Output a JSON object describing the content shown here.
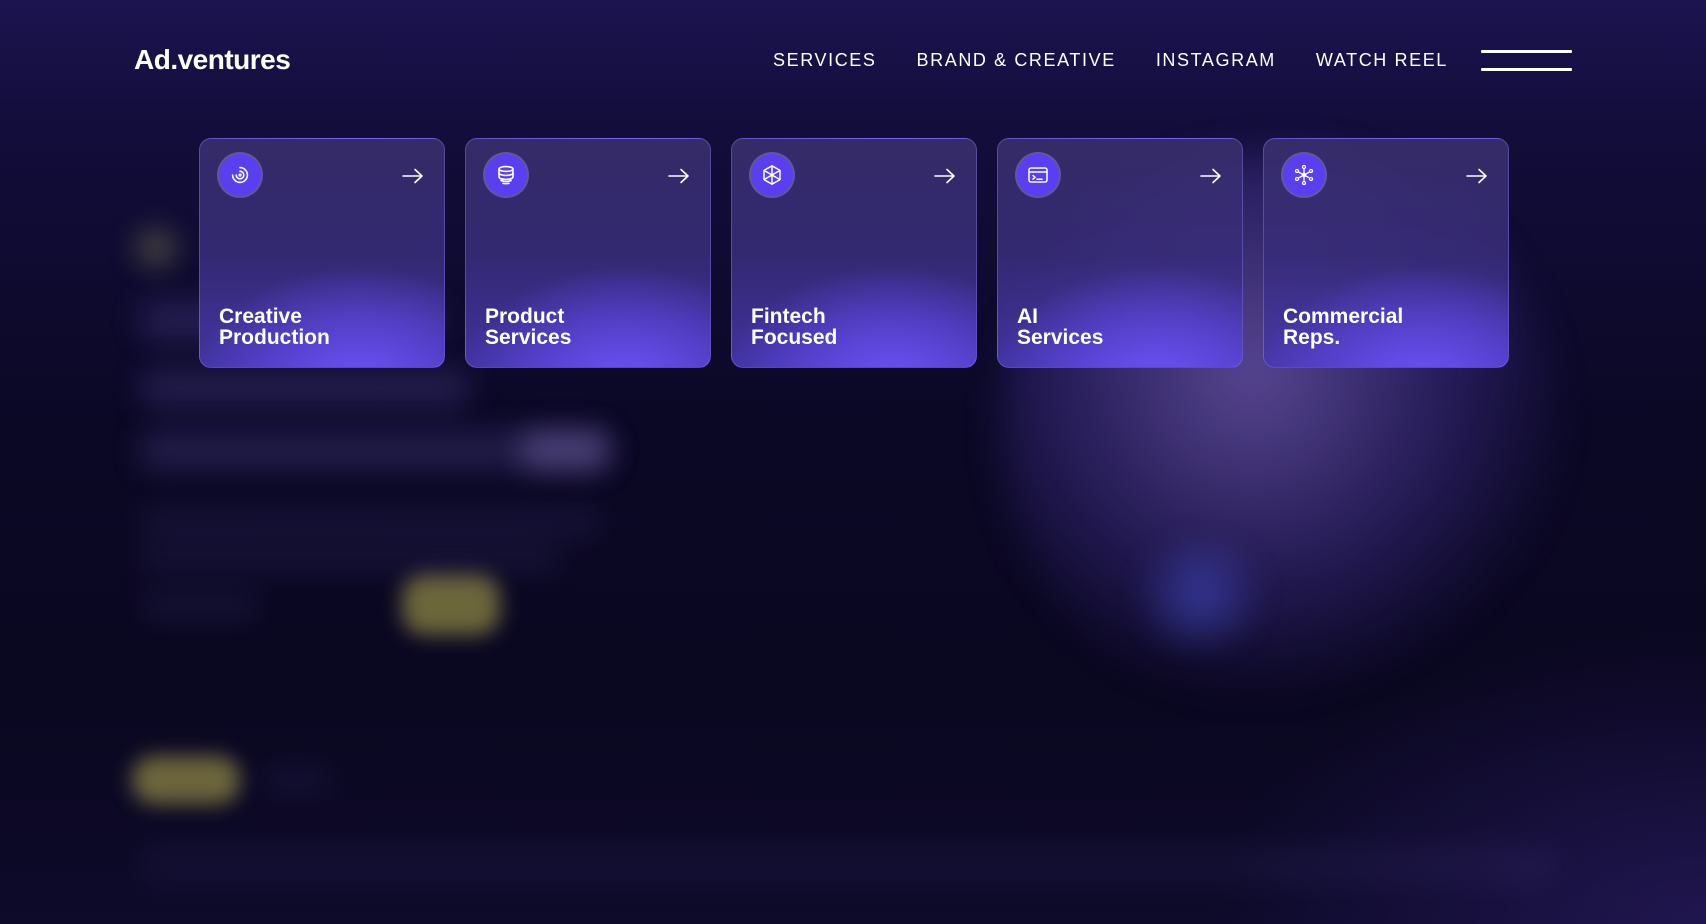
{
  "header": {
    "logo": "Ad.ventures",
    "nav": [
      {
        "label": "SERVICES"
      },
      {
        "label": "BRAND & CREATIVE"
      },
      {
        "label": "INSTAGRAM"
      },
      {
        "label": "WATCH REEL"
      }
    ],
    "menu_icon": "hamburger-menu-icon"
  },
  "cards": [
    {
      "title": "Creative\nProduction",
      "icon": "spiral-icon",
      "arrow": "arrow-right-icon"
    },
    {
      "title": "Product\nServices",
      "icon": "database-icon",
      "arrow": "arrow-right-icon"
    },
    {
      "title": "Fintech\nFocused",
      "icon": "cube-icon",
      "arrow": "arrow-right-icon"
    },
    {
      "title": "AI\nServices",
      "icon": "terminal-window-icon",
      "arrow": "arrow-right-icon"
    },
    {
      "title": "Commercial\nReps.",
      "icon": "network-icon",
      "arrow": "arrow-right-icon"
    }
  ],
  "colors": {
    "background": "#0b0826",
    "accent": "#5a3ff0",
    "card_glow": "#6e55ff",
    "text": "#ffffff"
  }
}
